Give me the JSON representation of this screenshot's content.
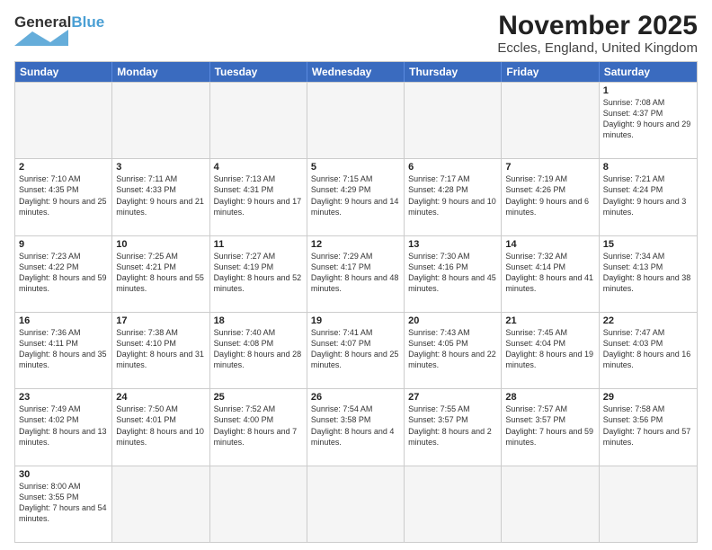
{
  "header": {
    "logo_general": "General",
    "logo_blue": "Blue",
    "title": "November 2025",
    "subtitle": "Eccles, England, United Kingdom"
  },
  "days": [
    "Sunday",
    "Monday",
    "Tuesday",
    "Wednesday",
    "Thursday",
    "Friday",
    "Saturday"
  ],
  "weeks": [
    [
      {
        "day": "",
        "text": ""
      },
      {
        "day": "",
        "text": ""
      },
      {
        "day": "",
        "text": ""
      },
      {
        "day": "",
        "text": ""
      },
      {
        "day": "",
        "text": ""
      },
      {
        "day": "",
        "text": ""
      },
      {
        "day": "1",
        "text": "Sunrise: 7:08 AM\nSunset: 4:37 PM\nDaylight: 9 hours and 29 minutes."
      }
    ],
    [
      {
        "day": "2",
        "text": "Sunrise: 7:10 AM\nSunset: 4:35 PM\nDaylight: 9 hours and 25 minutes."
      },
      {
        "day": "3",
        "text": "Sunrise: 7:11 AM\nSunset: 4:33 PM\nDaylight: 9 hours and 21 minutes."
      },
      {
        "day": "4",
        "text": "Sunrise: 7:13 AM\nSunset: 4:31 PM\nDaylight: 9 hours and 17 minutes."
      },
      {
        "day": "5",
        "text": "Sunrise: 7:15 AM\nSunset: 4:29 PM\nDaylight: 9 hours and 14 minutes."
      },
      {
        "day": "6",
        "text": "Sunrise: 7:17 AM\nSunset: 4:28 PM\nDaylight: 9 hours and 10 minutes."
      },
      {
        "day": "7",
        "text": "Sunrise: 7:19 AM\nSunset: 4:26 PM\nDaylight: 9 hours and 6 minutes."
      },
      {
        "day": "8",
        "text": "Sunrise: 7:21 AM\nSunset: 4:24 PM\nDaylight: 9 hours and 3 minutes."
      }
    ],
    [
      {
        "day": "9",
        "text": "Sunrise: 7:23 AM\nSunset: 4:22 PM\nDaylight: 8 hours and 59 minutes."
      },
      {
        "day": "10",
        "text": "Sunrise: 7:25 AM\nSunset: 4:21 PM\nDaylight: 8 hours and 55 minutes."
      },
      {
        "day": "11",
        "text": "Sunrise: 7:27 AM\nSunset: 4:19 PM\nDaylight: 8 hours and 52 minutes."
      },
      {
        "day": "12",
        "text": "Sunrise: 7:29 AM\nSunset: 4:17 PM\nDaylight: 8 hours and 48 minutes."
      },
      {
        "day": "13",
        "text": "Sunrise: 7:30 AM\nSunset: 4:16 PM\nDaylight: 8 hours and 45 minutes."
      },
      {
        "day": "14",
        "text": "Sunrise: 7:32 AM\nSunset: 4:14 PM\nDaylight: 8 hours and 41 minutes."
      },
      {
        "day": "15",
        "text": "Sunrise: 7:34 AM\nSunset: 4:13 PM\nDaylight: 8 hours and 38 minutes."
      }
    ],
    [
      {
        "day": "16",
        "text": "Sunrise: 7:36 AM\nSunset: 4:11 PM\nDaylight: 8 hours and 35 minutes."
      },
      {
        "day": "17",
        "text": "Sunrise: 7:38 AM\nSunset: 4:10 PM\nDaylight: 8 hours and 31 minutes."
      },
      {
        "day": "18",
        "text": "Sunrise: 7:40 AM\nSunset: 4:08 PM\nDaylight: 8 hours and 28 minutes."
      },
      {
        "day": "19",
        "text": "Sunrise: 7:41 AM\nSunset: 4:07 PM\nDaylight: 8 hours and 25 minutes."
      },
      {
        "day": "20",
        "text": "Sunrise: 7:43 AM\nSunset: 4:05 PM\nDaylight: 8 hours and 22 minutes."
      },
      {
        "day": "21",
        "text": "Sunrise: 7:45 AM\nSunset: 4:04 PM\nDaylight: 8 hours and 19 minutes."
      },
      {
        "day": "22",
        "text": "Sunrise: 7:47 AM\nSunset: 4:03 PM\nDaylight: 8 hours and 16 minutes."
      }
    ],
    [
      {
        "day": "23",
        "text": "Sunrise: 7:49 AM\nSunset: 4:02 PM\nDaylight: 8 hours and 13 minutes."
      },
      {
        "day": "24",
        "text": "Sunrise: 7:50 AM\nSunset: 4:01 PM\nDaylight: 8 hours and 10 minutes."
      },
      {
        "day": "25",
        "text": "Sunrise: 7:52 AM\nSunset: 4:00 PM\nDaylight: 8 hours and 7 minutes."
      },
      {
        "day": "26",
        "text": "Sunrise: 7:54 AM\nSunset: 3:58 PM\nDaylight: 8 hours and 4 minutes."
      },
      {
        "day": "27",
        "text": "Sunrise: 7:55 AM\nSunset: 3:57 PM\nDaylight: 8 hours and 2 minutes."
      },
      {
        "day": "28",
        "text": "Sunrise: 7:57 AM\nSunset: 3:57 PM\nDaylight: 7 hours and 59 minutes."
      },
      {
        "day": "29",
        "text": "Sunrise: 7:58 AM\nSunset: 3:56 PM\nDaylight: 7 hours and 57 minutes."
      }
    ],
    [
      {
        "day": "30",
        "text": "Sunrise: 8:00 AM\nSunset: 3:55 PM\nDaylight: 7 hours and 54 minutes."
      },
      {
        "day": "",
        "text": ""
      },
      {
        "day": "",
        "text": ""
      },
      {
        "day": "",
        "text": ""
      },
      {
        "day": "",
        "text": ""
      },
      {
        "day": "",
        "text": ""
      },
      {
        "day": "",
        "text": ""
      }
    ]
  ]
}
